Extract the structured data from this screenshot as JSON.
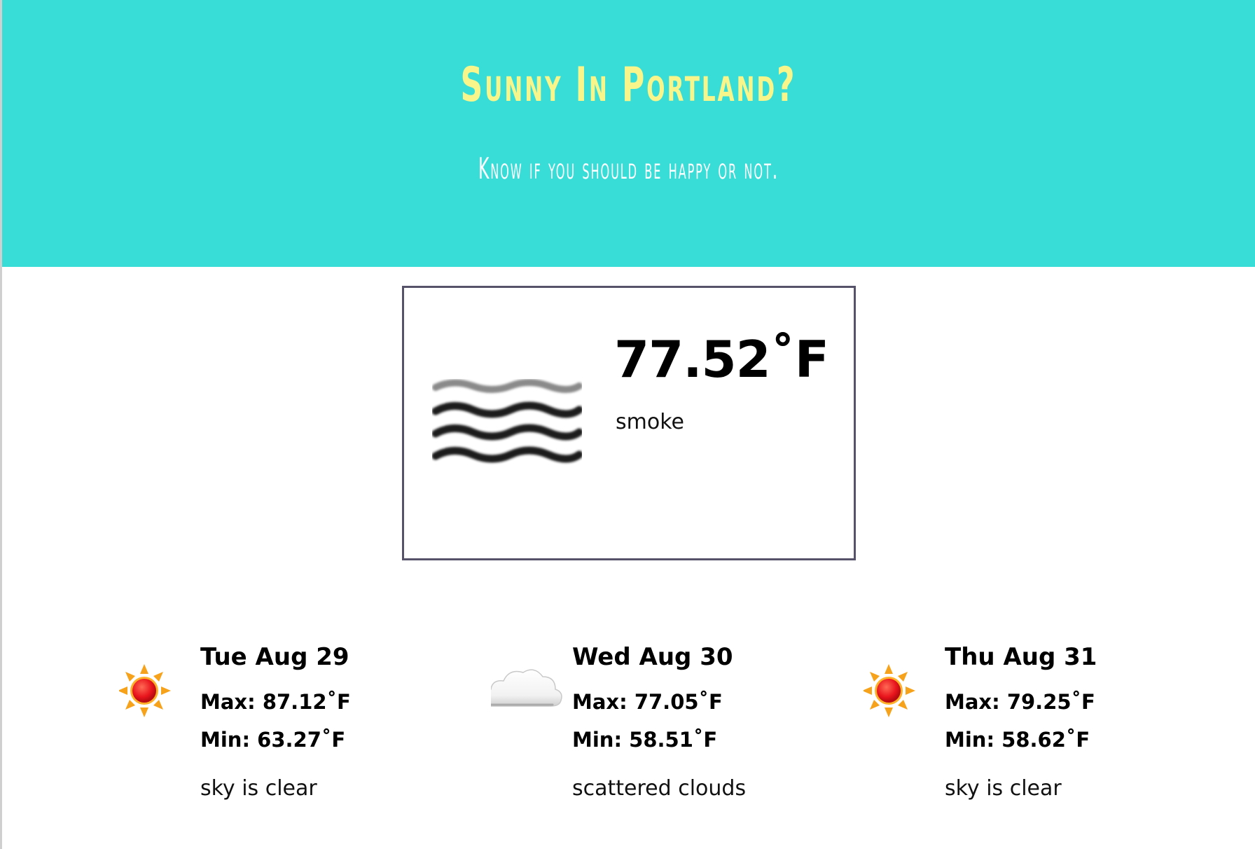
{
  "header": {
    "title": "Sunny In Portland?",
    "subtitle": "Know if you should be happy or not.",
    "background_color": "#38ddd7",
    "title_color": "#f8f58a",
    "subtitle_color": "#ffffff"
  },
  "current": {
    "icon": "fog-icon",
    "temperature": "77.52˚F",
    "description": "smoke",
    "border_color": "#56526a"
  },
  "forecast": [
    {
      "icon": "sun-icon",
      "day": "Tue Aug 29",
      "max": "Max: 87.12˚F",
      "min": "Min: 63.27˚F",
      "description": "sky is clear"
    },
    {
      "icon": "cloud-icon",
      "day": "Wed Aug 30",
      "max": "Max: 77.05˚F",
      "min": "Min: 58.51˚F",
      "description": "scattered clouds"
    },
    {
      "icon": "sun-icon",
      "day": "Thu Aug 31",
      "max": "Max: 79.25˚F",
      "min": "Min: 58.62˚F",
      "description": "sky is clear"
    }
  ]
}
